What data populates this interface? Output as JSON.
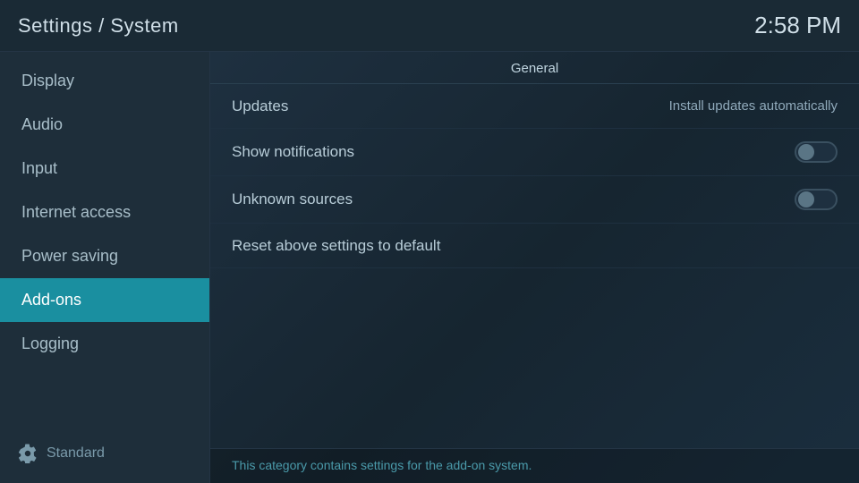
{
  "header": {
    "title": "Settings / System",
    "time": "2:58 PM"
  },
  "sidebar": {
    "items": [
      {
        "id": "display",
        "label": "Display",
        "active": false
      },
      {
        "id": "audio",
        "label": "Audio",
        "active": false
      },
      {
        "id": "input",
        "label": "Input",
        "active": false
      },
      {
        "id": "internet-access",
        "label": "Internet access",
        "active": false
      },
      {
        "id": "power-saving",
        "label": "Power saving",
        "active": false
      },
      {
        "id": "add-ons",
        "label": "Add-ons",
        "active": true
      },
      {
        "id": "logging",
        "label": "Logging",
        "active": false
      }
    ],
    "footer_label": "Standard",
    "footer_icon": "gear"
  },
  "content": {
    "section_header": "General",
    "settings": [
      {
        "id": "updates",
        "label": "Updates",
        "value": "Install updates automatically",
        "type": "value"
      },
      {
        "id": "show-notifications",
        "label": "Show notifications",
        "value": "",
        "type": "toggle",
        "enabled": false
      },
      {
        "id": "unknown-sources",
        "label": "Unknown sources",
        "value": "",
        "type": "toggle",
        "enabled": false
      },
      {
        "id": "reset",
        "label": "Reset above settings to default",
        "type": "action"
      }
    ],
    "footer_text": "This category contains settings for the add-on system."
  }
}
